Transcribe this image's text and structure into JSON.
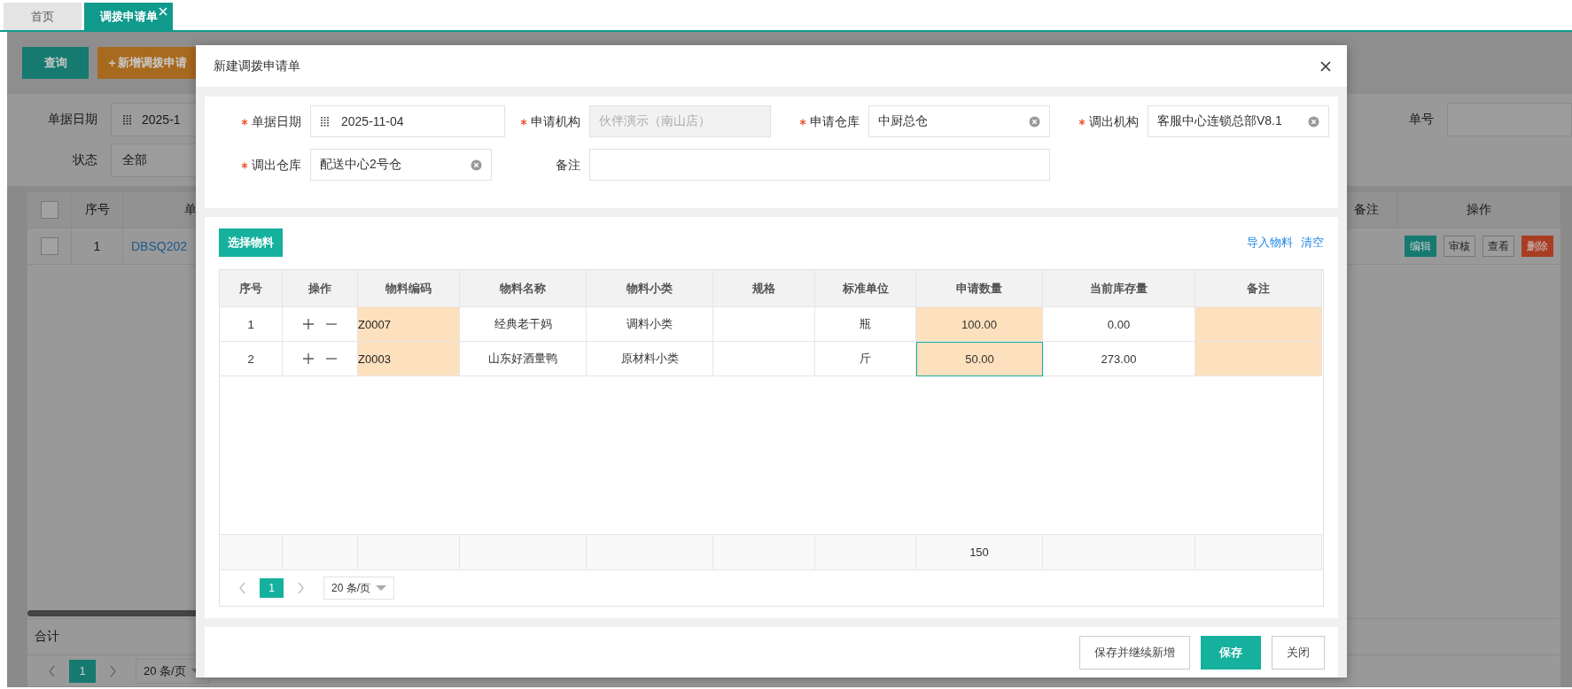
{
  "tabs": [
    {
      "label": "首页",
      "selected": false,
      "closable": false
    },
    {
      "label": "调拨申请单",
      "selected": true,
      "closable": true
    }
  ],
  "background": {
    "toolbar": [
      {
        "label": "查询",
        "kind": "primary"
      },
      {
        "label": "＋新增调拨申请",
        "kind": "add"
      }
    ],
    "filters": {
      "date_label": "单据日期",
      "date_value": "2025-1",
      "status_label": "状态",
      "status_value": "全部",
      "number_label": "单号"
    },
    "table": {
      "header_checked": false,
      "columns_left": [
        "序号",
        "单"
      ],
      "columns_right": [
        "备注",
        "操作"
      ],
      "rows": [
        {
          "checked": false,
          "index": "1",
          "number": "DBSQ202",
          "actions": [
            {
              "label": "编辑",
              "kind": "edit"
            },
            {
              "label": "审核",
              "kind": "plain"
            },
            {
              "label": "查看",
              "kind": "plain"
            },
            {
              "label": "删除",
              "kind": "danger"
            }
          ]
        }
      ]
    },
    "footer": {
      "total_label": "合计",
      "page": "1",
      "page_size": "20 条/页"
    }
  },
  "modal": {
    "title": "新建调拨申请单",
    "fields": [
      {
        "label": "单据日期",
        "required": true,
        "kind": "date",
        "value": "2025-11-04",
        "clearable": false,
        "disabled": false
      },
      {
        "label": "申请机构",
        "required": true,
        "kind": "text",
        "value": "伙伴演示（南山店）",
        "clearable": false,
        "disabled": true
      },
      {
        "label": "申请仓库",
        "required": true,
        "kind": "select",
        "value": "中厨总仓",
        "clearable": true,
        "disabled": false
      },
      {
        "label": "调出机构",
        "required": true,
        "kind": "select",
        "value": "客服中心连锁总部V8.1",
        "clearable": true,
        "disabled": false
      },
      {
        "label": "调出仓库",
        "required": true,
        "kind": "select",
        "value": "配送中心2号仓",
        "clearable": true,
        "disabled": false
      },
      {
        "label": "备注",
        "required": false,
        "kind": "wide",
        "clearable": false,
        "disabled": false
      }
    ],
    "items": {
      "select_button": "选择物料",
      "links": [
        "导入物料",
        "清空"
      ],
      "columns": [
        {
          "label": "序号",
          "kind": "index",
          "editable": false
        },
        {
          "label": "操作",
          "kind": "ops",
          "editable": false
        },
        {
          "label": "物料编码",
          "kind": "code",
          "editable": true
        },
        {
          "label": "物料名称",
          "kind": "name",
          "editable": false
        },
        {
          "label": "物料小类",
          "kind": "category",
          "editable": false
        },
        {
          "label": "规格",
          "kind": "spec",
          "editable": false
        },
        {
          "label": "标准单位",
          "kind": "unit",
          "editable": false
        },
        {
          "label": "申请数量",
          "kind": "quantity",
          "editable": true
        },
        {
          "label": "当前库存量",
          "kind": "stock",
          "editable": false
        },
        {
          "label": "备注",
          "kind": "remark",
          "editable": true
        }
      ],
      "rows": [
        {
          "index": "1",
          "code": "Z0007",
          "name": "经典老干妈",
          "category": "调料小类",
          "unit": "瓶",
          "quantity": "100.00",
          "stock": "0.00",
          "quantity_focused": false
        },
        {
          "index": "2",
          "code": "Z0003",
          "name": "山东好酒量鸭",
          "category": "原材料小类",
          "unit": "斤",
          "quantity": "50.00",
          "stock": "273.00",
          "quantity_focused": true
        }
      ],
      "summary_quantity": "150",
      "page": "1",
      "page_size": "20 条/页"
    },
    "buttons": [
      {
        "label": "保存并继续新增",
        "kind": "default"
      },
      {
        "label": "保存",
        "kind": "primary"
      },
      {
        "label": "关闭",
        "kind": "default"
      }
    ]
  }
}
